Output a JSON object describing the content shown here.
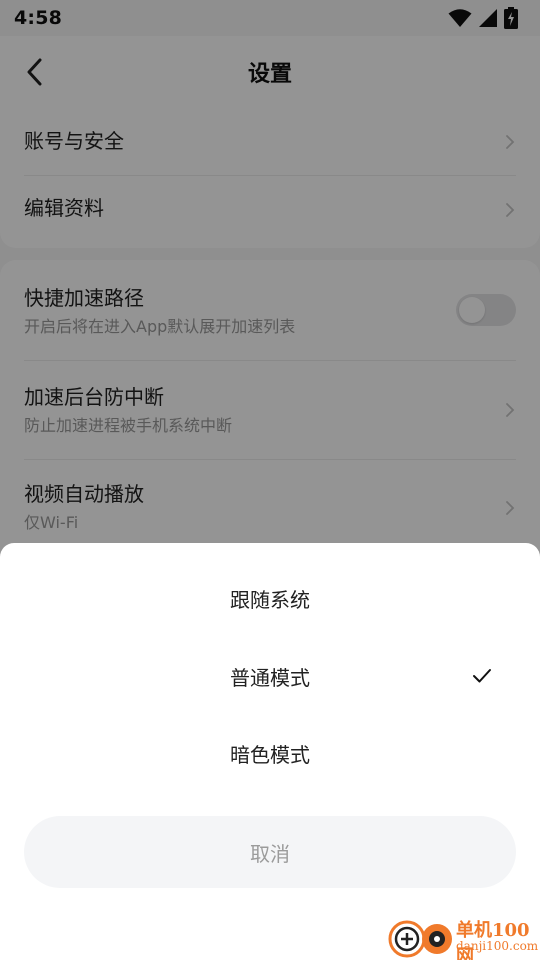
{
  "status_bar": {
    "time": "4:58",
    "icons": [
      "wifi-icon",
      "signal-icon",
      "battery-charging-icon"
    ]
  },
  "app_bar": {
    "title": "设置",
    "back_icon": "chevron-left-icon"
  },
  "settings": {
    "group_1": [
      {
        "title": "账号与安全"
      },
      {
        "title": "编辑资料"
      }
    ],
    "group_2": [
      {
        "title": "快捷加速路径",
        "subtitle": "开启后将在进入App默认展开加速列表",
        "toggle": false
      },
      {
        "title": "加速后台防中断",
        "subtitle": "防止加速进程被手机系统中断"
      },
      {
        "title": "视频自动播放",
        "subtitle": "仅Wi-Fi"
      }
    ]
  },
  "sheet": {
    "options": [
      {
        "label": "跟随系统",
        "selected": false
      },
      {
        "label": "普通模式",
        "selected": true
      },
      {
        "label": "暗色模式",
        "selected": false
      }
    ],
    "cancel_label": "取消"
  },
  "watermark": {
    "name": "单机100网",
    "url": "danji100.com"
  },
  "colors": {
    "accent": "#f07a2b",
    "scrim": "rgba(0,0,0,0.42)",
    "sheet_bg": "#ffffff",
    "cancel_bg": "#f4f5f7"
  }
}
